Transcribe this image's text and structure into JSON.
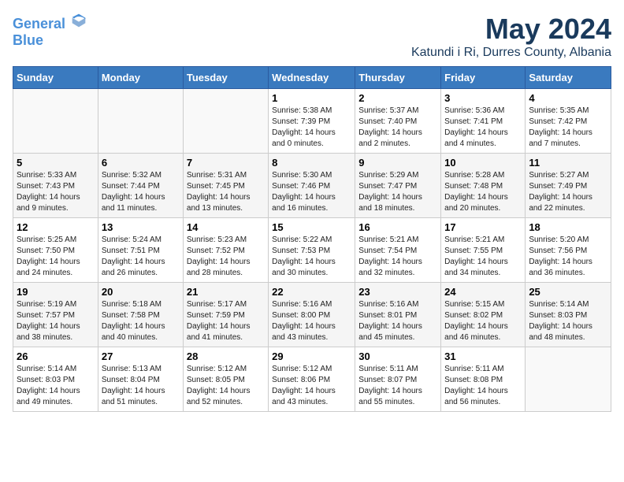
{
  "header": {
    "logo_line1": "General",
    "logo_line2": "Blue",
    "title": "May 2024",
    "subtitle": "Katundi i Ri, Durres County, Albania"
  },
  "weekdays": [
    "Sunday",
    "Monday",
    "Tuesday",
    "Wednesday",
    "Thursday",
    "Friday",
    "Saturday"
  ],
  "weeks": [
    [
      {
        "day": "",
        "detail": ""
      },
      {
        "day": "",
        "detail": ""
      },
      {
        "day": "",
        "detail": ""
      },
      {
        "day": "1",
        "detail": "Sunrise: 5:38 AM\nSunset: 7:39 PM\nDaylight: 14 hours\nand 0 minutes."
      },
      {
        "day": "2",
        "detail": "Sunrise: 5:37 AM\nSunset: 7:40 PM\nDaylight: 14 hours\nand 2 minutes."
      },
      {
        "day": "3",
        "detail": "Sunrise: 5:36 AM\nSunset: 7:41 PM\nDaylight: 14 hours\nand 4 minutes."
      },
      {
        "day": "4",
        "detail": "Sunrise: 5:35 AM\nSunset: 7:42 PM\nDaylight: 14 hours\nand 7 minutes."
      }
    ],
    [
      {
        "day": "5",
        "detail": "Sunrise: 5:33 AM\nSunset: 7:43 PM\nDaylight: 14 hours\nand 9 minutes."
      },
      {
        "day": "6",
        "detail": "Sunrise: 5:32 AM\nSunset: 7:44 PM\nDaylight: 14 hours\nand 11 minutes."
      },
      {
        "day": "7",
        "detail": "Sunrise: 5:31 AM\nSunset: 7:45 PM\nDaylight: 14 hours\nand 13 minutes."
      },
      {
        "day": "8",
        "detail": "Sunrise: 5:30 AM\nSunset: 7:46 PM\nDaylight: 14 hours\nand 16 minutes."
      },
      {
        "day": "9",
        "detail": "Sunrise: 5:29 AM\nSunset: 7:47 PM\nDaylight: 14 hours\nand 18 minutes."
      },
      {
        "day": "10",
        "detail": "Sunrise: 5:28 AM\nSunset: 7:48 PM\nDaylight: 14 hours\nand 20 minutes."
      },
      {
        "day": "11",
        "detail": "Sunrise: 5:27 AM\nSunset: 7:49 PM\nDaylight: 14 hours\nand 22 minutes."
      }
    ],
    [
      {
        "day": "12",
        "detail": "Sunrise: 5:25 AM\nSunset: 7:50 PM\nDaylight: 14 hours\nand 24 minutes."
      },
      {
        "day": "13",
        "detail": "Sunrise: 5:24 AM\nSunset: 7:51 PM\nDaylight: 14 hours\nand 26 minutes."
      },
      {
        "day": "14",
        "detail": "Sunrise: 5:23 AM\nSunset: 7:52 PM\nDaylight: 14 hours\nand 28 minutes."
      },
      {
        "day": "15",
        "detail": "Sunrise: 5:22 AM\nSunset: 7:53 PM\nDaylight: 14 hours\nand 30 minutes."
      },
      {
        "day": "16",
        "detail": "Sunrise: 5:21 AM\nSunset: 7:54 PM\nDaylight: 14 hours\nand 32 minutes."
      },
      {
        "day": "17",
        "detail": "Sunrise: 5:21 AM\nSunset: 7:55 PM\nDaylight: 14 hours\nand 34 minutes."
      },
      {
        "day": "18",
        "detail": "Sunrise: 5:20 AM\nSunset: 7:56 PM\nDaylight: 14 hours\nand 36 minutes."
      }
    ],
    [
      {
        "day": "19",
        "detail": "Sunrise: 5:19 AM\nSunset: 7:57 PM\nDaylight: 14 hours\nand 38 minutes."
      },
      {
        "day": "20",
        "detail": "Sunrise: 5:18 AM\nSunset: 7:58 PM\nDaylight: 14 hours\nand 40 minutes."
      },
      {
        "day": "21",
        "detail": "Sunrise: 5:17 AM\nSunset: 7:59 PM\nDaylight: 14 hours\nand 41 minutes."
      },
      {
        "day": "22",
        "detail": "Sunrise: 5:16 AM\nSunset: 8:00 PM\nDaylight: 14 hours\nand 43 minutes."
      },
      {
        "day": "23",
        "detail": "Sunrise: 5:16 AM\nSunset: 8:01 PM\nDaylight: 14 hours\nand 45 minutes."
      },
      {
        "day": "24",
        "detail": "Sunrise: 5:15 AM\nSunset: 8:02 PM\nDaylight: 14 hours\nand 46 minutes."
      },
      {
        "day": "25",
        "detail": "Sunrise: 5:14 AM\nSunset: 8:03 PM\nDaylight: 14 hours\nand 48 minutes."
      }
    ],
    [
      {
        "day": "26",
        "detail": "Sunrise: 5:14 AM\nSunset: 8:03 PM\nDaylight: 14 hours\nand 49 minutes."
      },
      {
        "day": "27",
        "detail": "Sunrise: 5:13 AM\nSunset: 8:04 PM\nDaylight: 14 hours\nand 51 minutes."
      },
      {
        "day": "28",
        "detail": "Sunrise: 5:12 AM\nSunset: 8:05 PM\nDaylight: 14 hours\nand 52 minutes."
      },
      {
        "day": "29",
        "detail": "Sunrise: 5:12 AM\nSunset: 8:06 PM\nDaylight: 14 hours\nand 43 minutes."
      },
      {
        "day": "30",
        "detail": "Sunrise: 5:11 AM\nSunset: 8:07 PM\nDaylight: 14 hours\nand 55 minutes."
      },
      {
        "day": "31",
        "detail": "Sunrise: 5:11 AM\nSunset: 8:08 PM\nDaylight: 14 hours\nand 56 minutes."
      },
      {
        "day": "",
        "detail": ""
      }
    ]
  ]
}
